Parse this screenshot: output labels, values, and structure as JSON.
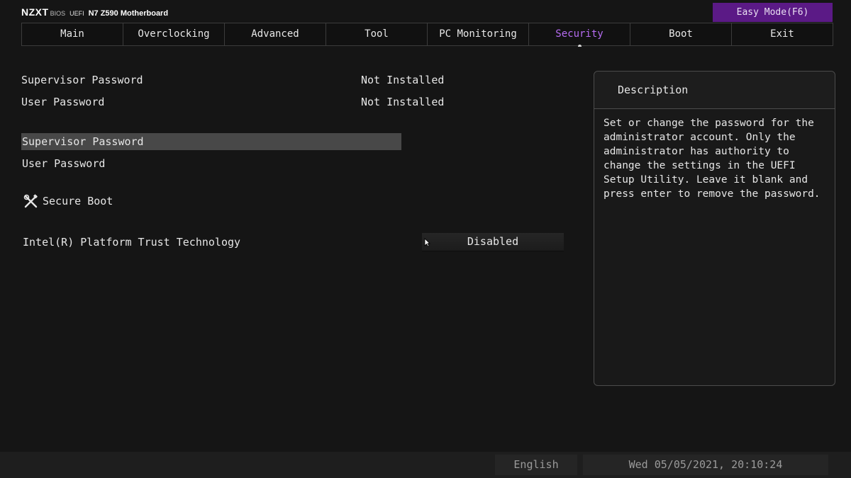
{
  "header": {
    "brand": "NZXT",
    "bios": "BIOS",
    "uefi": "UEFI",
    "model": "N7 Z590 Motherboard",
    "easy_mode": "Easy Mode(F6)"
  },
  "tabs": [
    {
      "label": "Main"
    },
    {
      "label": "Overclocking"
    },
    {
      "label": "Advanced"
    },
    {
      "label": "Tool"
    },
    {
      "label": "PC Monitoring"
    },
    {
      "label": "Security"
    },
    {
      "label": "Boot"
    },
    {
      "label": "Exit"
    }
  ],
  "active_tab": "Security",
  "status": {
    "supervisor_label": "Supervisor Password",
    "supervisor_value": "Not Installed",
    "user_label": "User Password",
    "user_value": "Not Installed"
  },
  "items": {
    "supervisor_password": "Supervisor Password",
    "user_password": "User Password",
    "secure_boot": "Secure Boot",
    "secure_boot_icon": "tools-icon"
  },
  "ptt": {
    "label": "Intel(R) Platform Trust Technology",
    "value": "Disabled"
  },
  "description": {
    "title": "Description",
    "text": "Set or change the password for the administrator account. Only the administrator has authority to change the settings in the UEFI Setup Utility. Leave it blank and press enter to remove the password."
  },
  "footer": {
    "language": "English",
    "datetime": "Wed 05/05/2021, 20:10:24"
  },
  "colors": {
    "accent": "#b66cf2",
    "easy_mode_bg": "#5b1a86",
    "highlight": "#484848"
  }
}
